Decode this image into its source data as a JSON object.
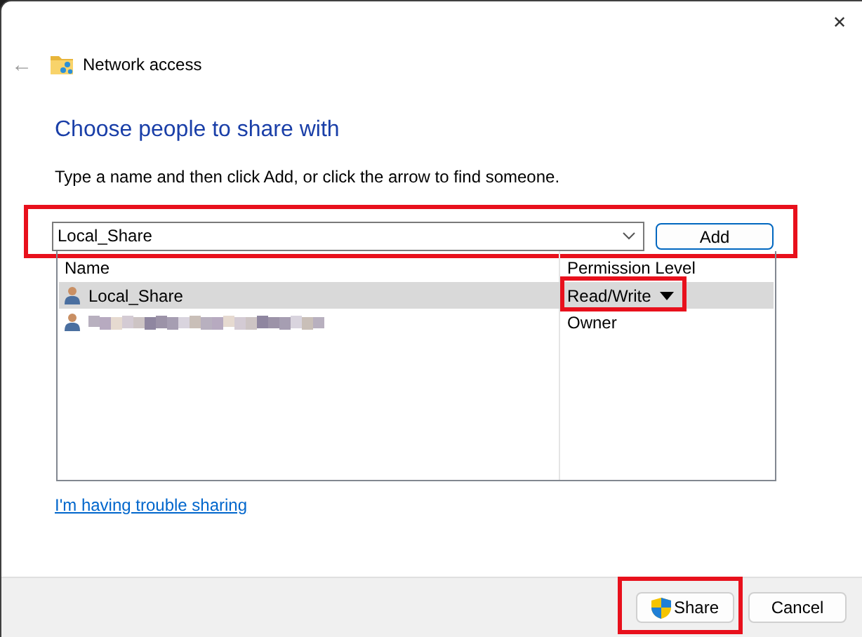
{
  "window": {
    "title": "Network access",
    "close": "✕",
    "back": "←"
  },
  "heading": "Choose people to share with",
  "instruction": "Type a name and then click Add, or click the arrow to find someone.",
  "name_field": {
    "value": "Local_Share",
    "highlighted": true
  },
  "add_button": {
    "label": "Add"
  },
  "table": {
    "columns": [
      "Name",
      "Permission Level"
    ],
    "rows": [
      {
        "name": "Local_Share",
        "redacted": false,
        "permission": "Read/Write",
        "has_dropdown": true,
        "selected": true,
        "highlighted": true
      },
      {
        "name": "",
        "redacted": true,
        "permission": "Owner",
        "has_dropdown": false,
        "selected": false,
        "highlighted": false
      }
    ]
  },
  "help_link": "I'm having trouble sharing",
  "buttons": [
    {
      "label": "Share",
      "kind": "shield",
      "highlighted": true
    },
    {
      "label": "Cancel",
      "kind": "plain",
      "highlighted": false
    }
  ]
}
